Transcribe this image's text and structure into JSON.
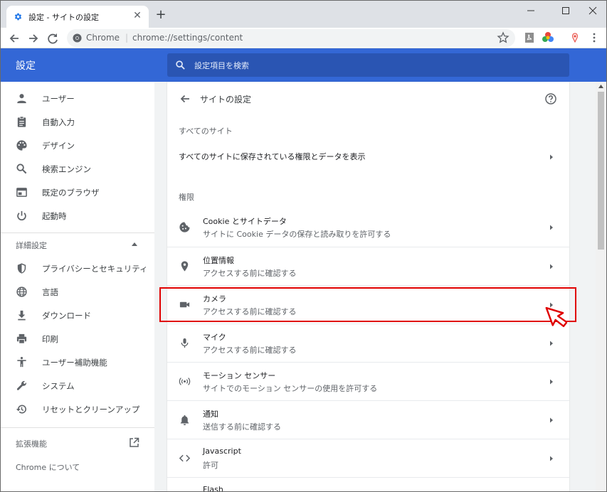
{
  "browser": {
    "tab_title": "設定 - サイトの設定",
    "tab_close": "✕",
    "new_tab": "+",
    "address_chrome": "Chrome",
    "address_separator": "|",
    "url": "chrome://settings/content"
  },
  "header": {
    "title": "設定",
    "search_placeholder": "設定項目を検索"
  },
  "sidebar": {
    "items": [
      {
        "label": "ユーザー",
        "icon": "person-icon"
      },
      {
        "label": "自動入力",
        "icon": "clipboard-icon"
      },
      {
        "label": "デザイン",
        "icon": "palette-icon"
      },
      {
        "label": "検索エンジン",
        "icon": "search-icon"
      },
      {
        "label": "既定のブラウザ",
        "icon": "browser-icon"
      },
      {
        "label": "起動時",
        "icon": "power-icon"
      }
    ],
    "advanced_label": "詳細設定",
    "advanced_items": [
      {
        "label": "プライバシーとセキュリティ",
        "icon": "shield-icon"
      },
      {
        "label": "言語",
        "icon": "globe-icon"
      },
      {
        "label": "ダウンロード",
        "icon": "download-icon"
      },
      {
        "label": "印刷",
        "icon": "printer-icon"
      },
      {
        "label": "ユーザー補助機能",
        "icon": "accessibility-icon"
      },
      {
        "label": "システム",
        "icon": "wrench-icon"
      },
      {
        "label": "リセットとクリーンアップ",
        "icon": "restore-icon"
      }
    ],
    "extensions_label": "拡張機能",
    "about_label": "Chrome について"
  },
  "main": {
    "title": "サイトの設定",
    "all_sites_heading": "すべてのサイト",
    "all_sites_link": "すべてのサイトに保存されている権限とデータを表示",
    "permissions_heading": "権限",
    "permissions": [
      {
        "title": "Cookie とサイトデータ",
        "subtitle": "サイトに Cookie データの保存と読み取りを許可する",
        "icon": "cookie-icon"
      },
      {
        "title": "位置情報",
        "subtitle": "アクセスする前に確認する",
        "icon": "location-pin-icon"
      },
      {
        "title": "カメラ",
        "subtitle": "アクセスする前に確認する",
        "icon": "camera-icon"
      },
      {
        "title": "マイク",
        "subtitle": "アクセスする前に確認する",
        "icon": "microphone-icon"
      },
      {
        "title": "モーション センサー",
        "subtitle": "サイトでのモーション センサーの使用を許可する",
        "icon": "sensor-icon"
      },
      {
        "title": "通知",
        "subtitle": "送信する前に確認する",
        "icon": "bell-icon"
      },
      {
        "title": "Javascript",
        "subtitle": "許可",
        "icon": "code-icon"
      },
      {
        "title": "Flash",
        "subtitle": "",
        "icon": "puzzle-icon"
      }
    ]
  },
  "colors": {
    "header_blue": "#3367d6",
    "search_blue": "#2a55b3",
    "highlight_red": "#e00000"
  }
}
